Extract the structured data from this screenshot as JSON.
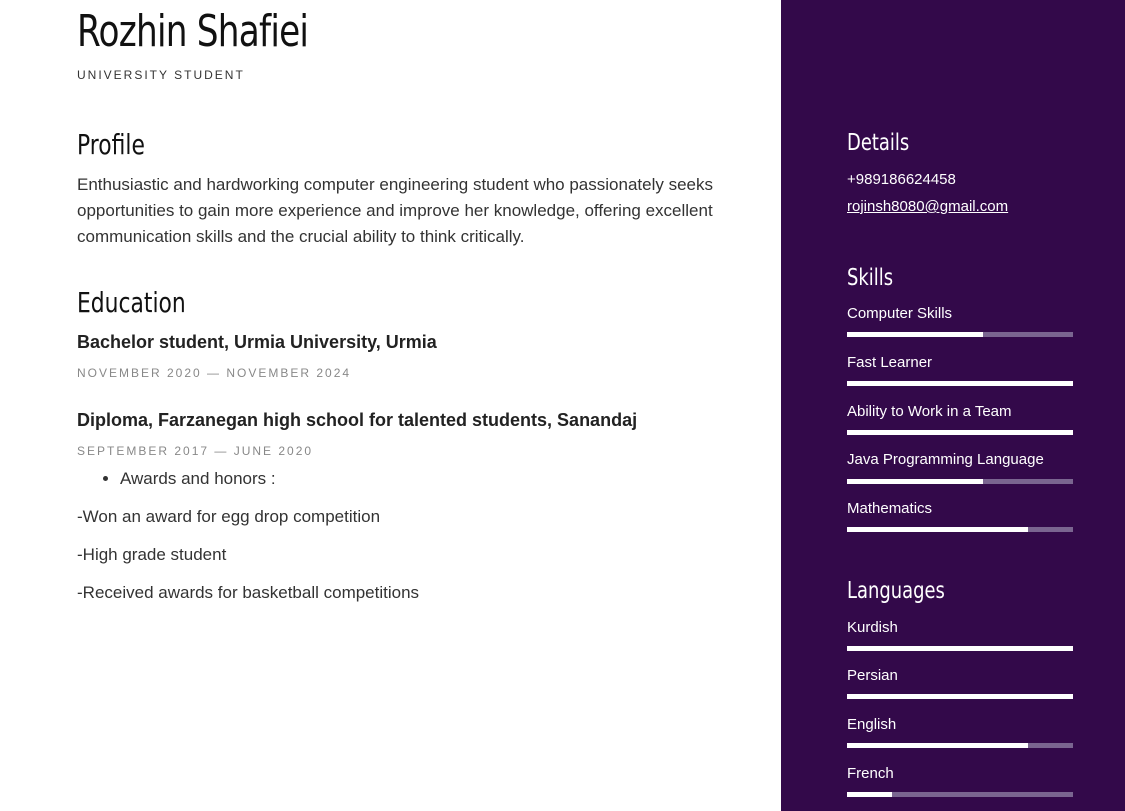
{
  "header": {
    "name": "Rozhin Shafiei",
    "subtitle": "UNIVERSITY STUDENT"
  },
  "profile": {
    "heading": "Profile",
    "text": " Enthusiastic and hardworking computer engineering student who passionately seeks opportunities to gain more experience and improve her knowledge, offering excellent communication skills and the crucial ability to think critically."
  },
  "education": {
    "heading": "Education",
    "items": [
      {
        "title": "Bachelor student, Urmia University, Urmia",
        "dates": "NOVEMBER 2020 — NOVEMBER 2024"
      },
      {
        "title": "Diploma, Farzanegan high school for talented students, Sanandaj",
        "dates": "SEPTEMBER 2017 — JUNE 2020"
      }
    ],
    "bullet": "Awards and honors :",
    "lines": [
      "-Won an award for egg drop competition",
      "-High grade student",
      "-Received awards for basketball competitions"
    ]
  },
  "sidebar": {
    "details_heading": "Details",
    "phone": "+989186624458",
    "email": "rojinsh8080@gmail.com",
    "skills_heading": "Skills",
    "skills": [
      {
        "label": "Computer Skills",
        "level": 0.6
      },
      {
        "label": "Fast Learner",
        "level": 1.0
      },
      {
        "label": "Ability to Work in a Team",
        "level": 1.0
      },
      {
        "label": "Java Programming Language",
        "level": 0.6
      },
      {
        "label": "Mathematics",
        "level": 0.8
      }
    ],
    "languages_heading": "Languages",
    "languages": [
      {
        "label": "Kurdish",
        "level": 1.0
      },
      {
        "label": "Persian",
        "level": 1.0
      },
      {
        "label": "English",
        "level": 0.8
      },
      {
        "label": "French",
        "level": 0.2
      }
    ]
  },
  "colors": {
    "sidebar_bg": "#33094a",
    "bar_track": "#7a6590",
    "bar_fill": "#ffffff"
  }
}
